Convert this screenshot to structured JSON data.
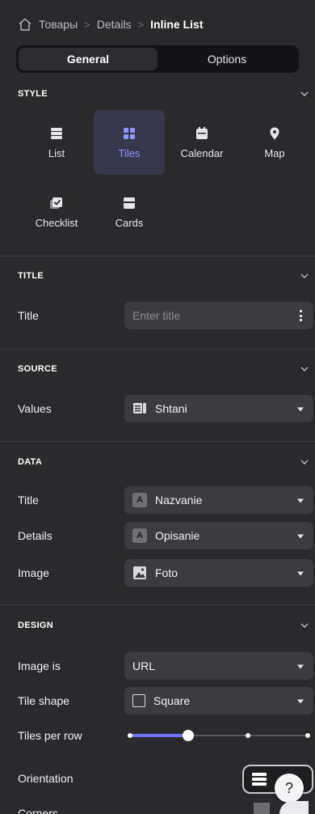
{
  "breadcrumb": {
    "items": [
      "Товары",
      "Details"
    ],
    "current": "Inline List"
  },
  "tabs": [
    {
      "label": "General"
    },
    {
      "label": "Options"
    }
  ],
  "style": {
    "header": "STYLE",
    "items": [
      {
        "label": "List",
        "icon": "list-icon"
      },
      {
        "label": "Tiles",
        "icon": "tiles-icon",
        "selected": true
      },
      {
        "label": "Calendar",
        "icon": "calendar-icon"
      },
      {
        "label": "Map",
        "icon": "map-pin-icon"
      },
      {
        "label": "Checklist",
        "icon": "checklist-icon"
      },
      {
        "label": "Cards",
        "icon": "cards-icon"
      }
    ]
  },
  "title_section": {
    "header": "TITLE",
    "label": "Title",
    "placeholder": "Enter title"
  },
  "source": {
    "header": "SOURCE",
    "label": "Values",
    "value": "Shtani"
  },
  "data": {
    "header": "DATA",
    "rows": [
      {
        "label": "Title",
        "value": "Nazvanie",
        "icon_text": "A"
      },
      {
        "label": "Details",
        "value": "Opisanie",
        "icon_text": "A"
      },
      {
        "label": "Image",
        "value": "Foto"
      }
    ]
  },
  "design": {
    "header": "DESIGN",
    "image_is_label": "Image is",
    "image_is_value": "URL",
    "tile_shape_label": "Tile shape",
    "tile_shape_value": "Square",
    "tiles_per_row_label": "Tiles per row",
    "tiles_per_row_fraction": 0.33,
    "orientation_label": "Orientation",
    "corners_label": "Corners"
  },
  "help": {
    "label": "?"
  },
  "colors": {
    "accent": "#6c74ff",
    "selected_bg": "#37384c",
    "panel_bg": "#2a2a2d",
    "field_bg": "#3b3b40"
  }
}
